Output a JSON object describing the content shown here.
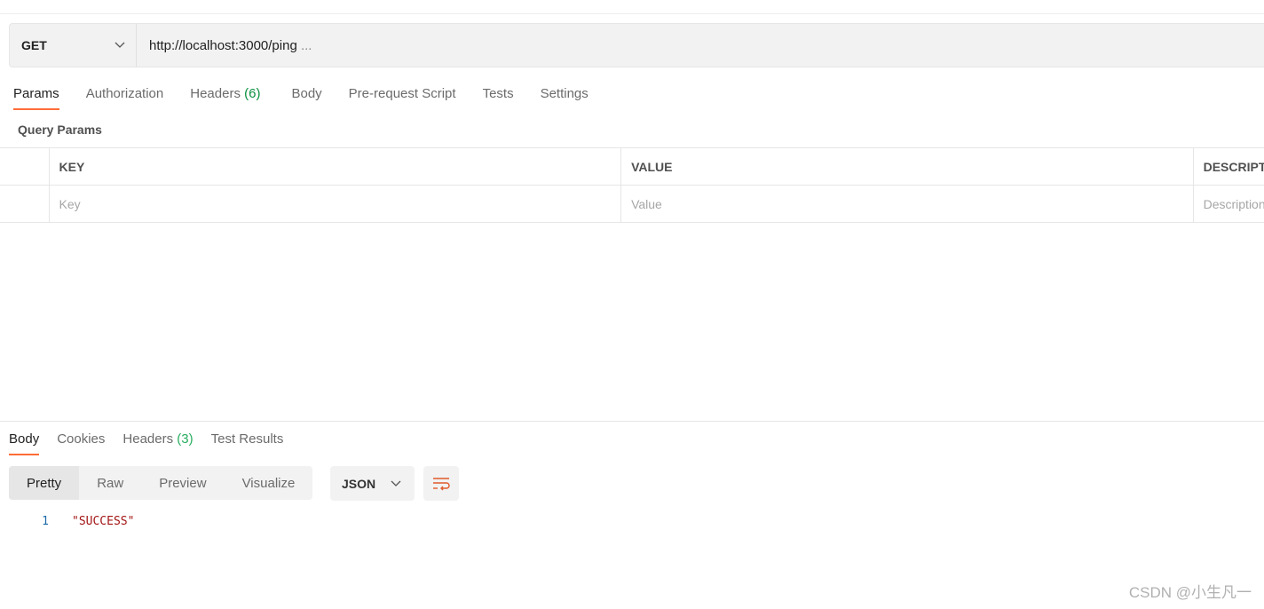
{
  "request": {
    "method": "GET",
    "url": "http://localhost:3000/ping",
    "url_ellipsis": "..."
  },
  "request_tabs": [
    {
      "label": "Params",
      "active": true
    },
    {
      "label": "Authorization"
    },
    {
      "label": "Headers",
      "count": "(6)"
    },
    {
      "label": "Body"
    },
    {
      "label": "Pre-request Script"
    },
    {
      "label": "Tests"
    },
    {
      "label": "Settings"
    }
  ],
  "query_params": {
    "title": "Query Params",
    "columns": [
      "KEY",
      "VALUE",
      "DESCRIPTION"
    ],
    "placeholders": [
      "Key",
      "Value",
      "Description"
    ]
  },
  "response_tabs": [
    {
      "label": "Body",
      "active": true
    },
    {
      "label": "Cookies"
    },
    {
      "label": "Headers",
      "count": "(3)"
    },
    {
      "label": "Test Results"
    }
  ],
  "view_modes": [
    "Pretty",
    "Raw",
    "Preview",
    "Visualize"
  ],
  "selected_view": "Pretty",
  "format": "JSON",
  "response_body": [
    {
      "line": "1",
      "text": "\"SUCCESS\""
    }
  ],
  "watermark": "CSDN @小生凡一",
  "colors": {
    "accent": "#ff6c37",
    "count": "#0a8f3f",
    "string": "#a31515"
  }
}
